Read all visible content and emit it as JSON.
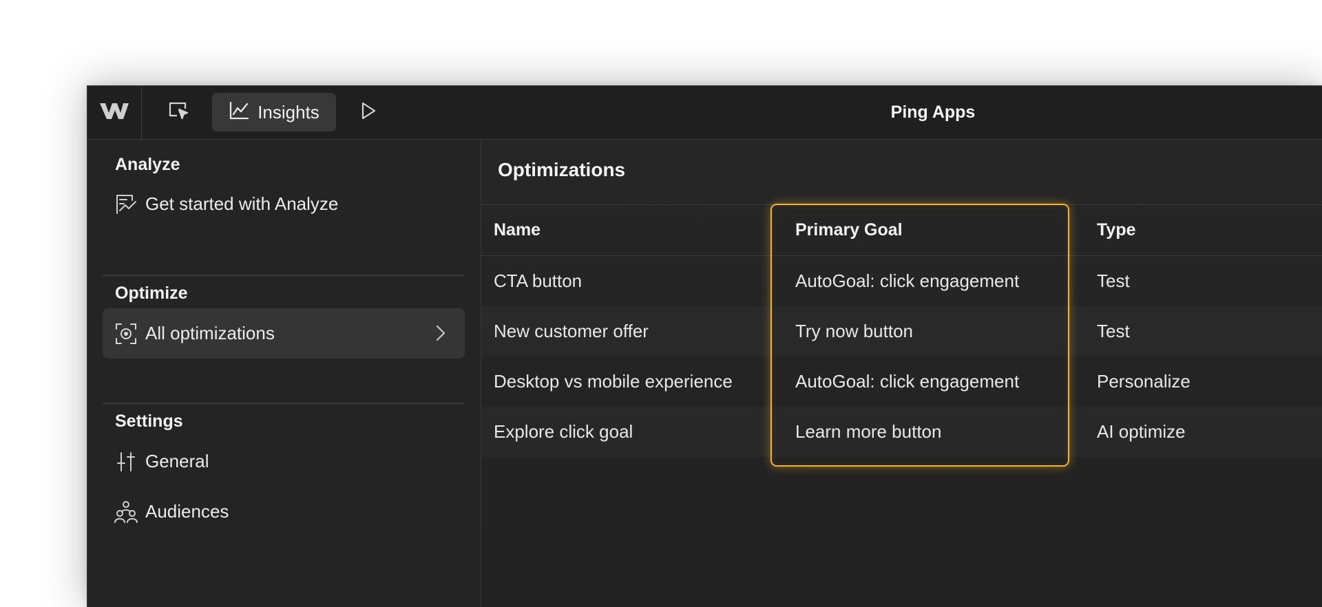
{
  "toolbar": {
    "logo_icon": "webflow-logo-icon",
    "select_icon": "cursor-select-icon",
    "insights_label": "Insights",
    "insights_icon": "line-chart-icon",
    "preview_icon": "play-icon",
    "app_title": "Ping Apps"
  },
  "sidebar": {
    "analyze": {
      "title": "Analyze",
      "items": [
        {
          "label": "Get started with Analyze",
          "icon": "analyze-chart-icon"
        }
      ]
    },
    "optimize": {
      "title": "Optimize",
      "items": [
        {
          "label": "All optimizations",
          "icon": "target-focus-icon",
          "active": true
        }
      ]
    },
    "settings": {
      "title": "Settings",
      "items": [
        {
          "label": "General",
          "icon": "sliders-icon"
        },
        {
          "label": "Audiences",
          "icon": "users-icon"
        }
      ]
    }
  },
  "main": {
    "title": "Optimizations",
    "columns": [
      "Name",
      "Primary Goal",
      "Type"
    ],
    "rows": [
      {
        "name": "CTA button",
        "goal": "AutoGoal: click engagement",
        "type": "Test"
      },
      {
        "name": "New customer offer",
        "goal": "Try now button",
        "type": "Test"
      },
      {
        "name": "Desktop vs mobile experience",
        "goal": "AutoGoal: click engagement",
        "type": "Personalize"
      },
      {
        "name": "Explore click goal",
        "goal": "Learn more button",
        "type": "AI optimize"
      }
    ]
  },
  "colors": {
    "highlight": "#f5b530",
    "background": "#262626",
    "topbar": "#1f1f1f"
  }
}
